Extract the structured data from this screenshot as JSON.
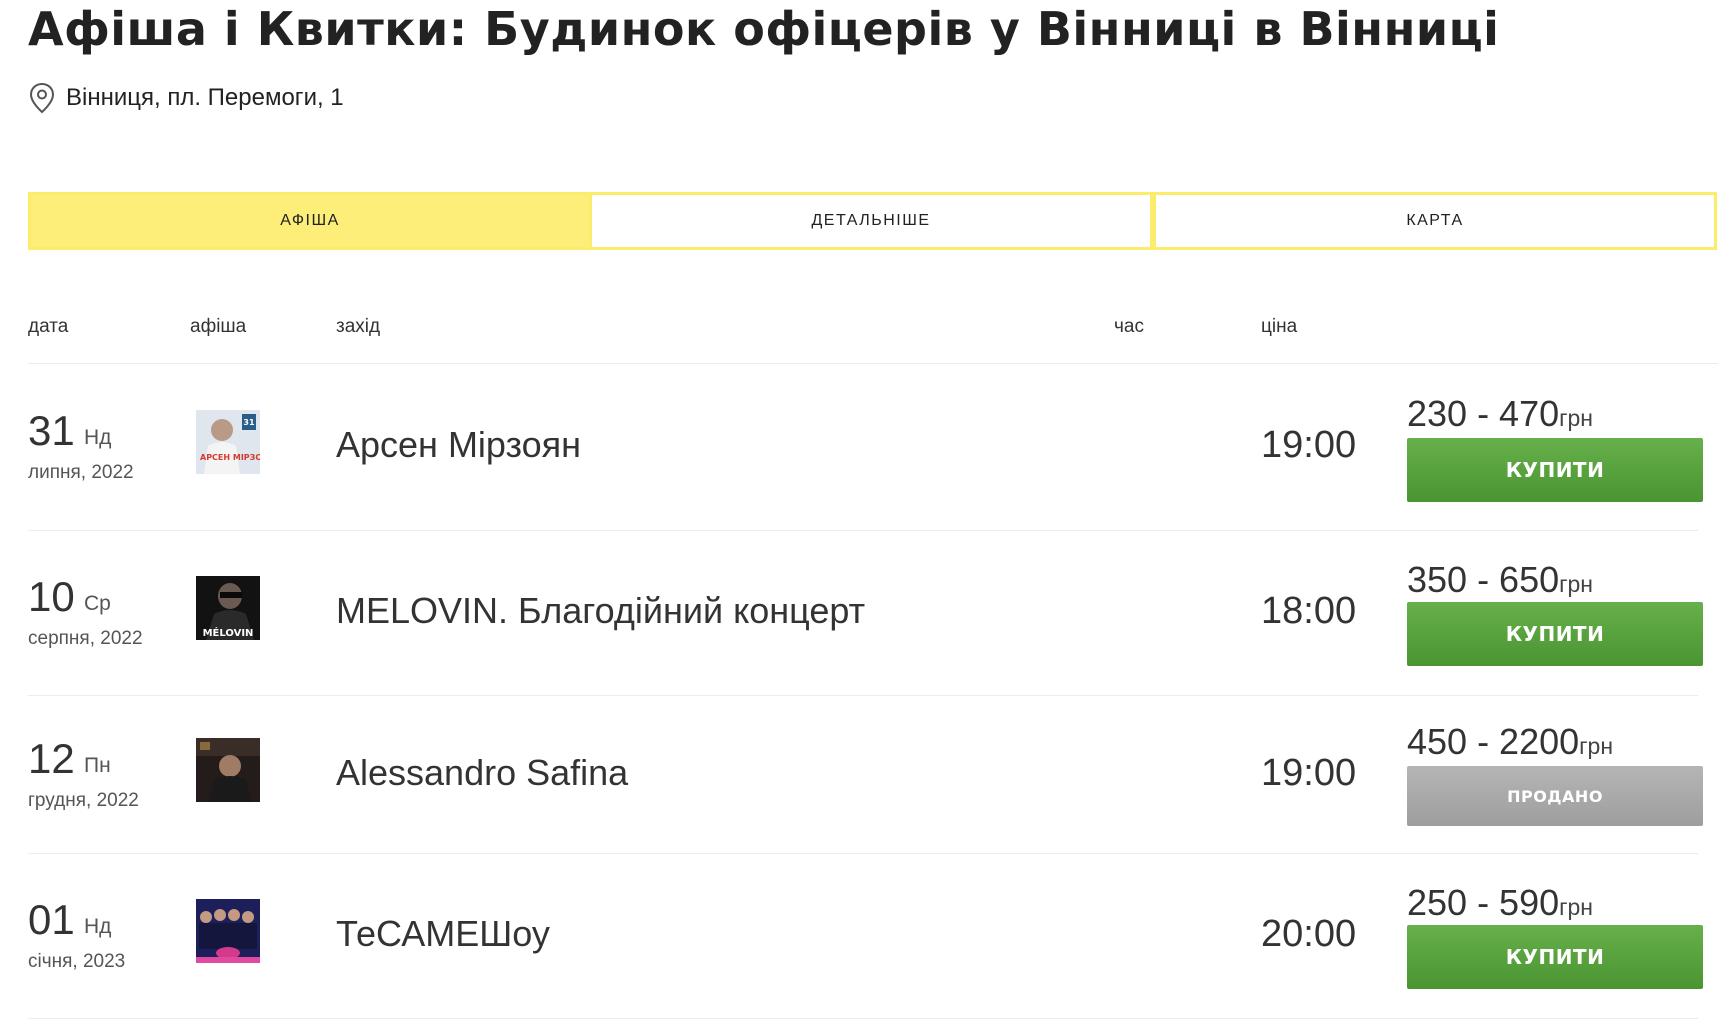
{
  "page": {
    "title": "Афіша і Квитки: Будинок офіцерів у Вінниці в Вінниці",
    "address": "Вінниця, пл. Перемоги, 1",
    "address_icon": "map-pin-icon"
  },
  "tabs": [
    {
      "label": "АФІША",
      "active": true
    },
    {
      "label": "ДЕТАЛЬНІШЕ",
      "active": false
    },
    {
      "label": "КАРТА",
      "active": false
    }
  ],
  "table": {
    "headers": {
      "date": "дата",
      "poster": "афіша",
      "event": "захід",
      "time": "час",
      "price": "ціна"
    },
    "rows": [
      {
        "day": "31",
        "weekday": "Нд",
        "month_year": "липня, 2022",
        "event": "Арсен Мірзоян",
        "time": "19:00",
        "price": "230 - 470",
        "currency": "грн",
        "button": "КУПИТИ",
        "sold_out": false,
        "poster_text": "АРСЕН МІРЗОЯН",
        "poster_number": "31"
      },
      {
        "day": "10",
        "weekday": "Ср",
        "month_year": "серпня, 2022",
        "event": "MELOVIN. Благодійний концерт",
        "time": "18:00",
        "price": "350 - 650",
        "currency": "грн",
        "button": "КУПИТИ",
        "sold_out": false,
        "poster_text": "MÉLOVIN"
      },
      {
        "day": "12",
        "weekday": "Пн",
        "month_year": "грудня, 2022",
        "event": "Alessandro Safina",
        "time": "19:00",
        "price": "450 - 2200",
        "currency": "грн",
        "button": "ПРОДАНО",
        "sold_out": true
      },
      {
        "day": "01",
        "weekday": "Нд",
        "month_year": "січня, 2023",
        "event": "ТеСАМЕШоу",
        "time": "20:00",
        "price": "250 - 590",
        "currency": "грн",
        "button": "КУПИТИ",
        "sold_out": false
      }
    ]
  },
  "colors": {
    "accent_yellow": "#fcee78",
    "buy_green": "#4f9a36",
    "sold_grey": "#a6a6a6"
  }
}
